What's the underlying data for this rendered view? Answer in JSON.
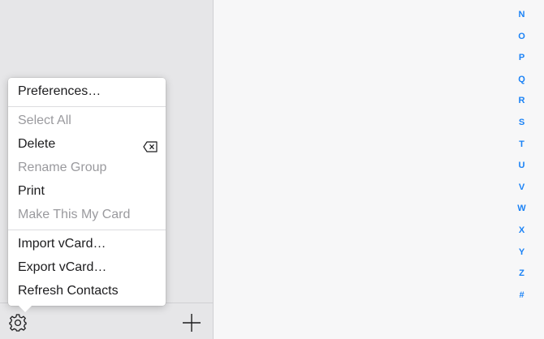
{
  "sidebar": {
    "footer": {
      "settings_icon": "gear-icon",
      "add_icon": "plus-icon"
    }
  },
  "menu": {
    "items": [
      {
        "label": "Preferences…",
        "enabled": true
      },
      {
        "label": "Select All",
        "enabled": false
      },
      {
        "label": "Delete",
        "enabled": true,
        "shortcut_icon": "delete-key-icon"
      },
      {
        "label": "Rename Group",
        "enabled": false
      },
      {
        "label": "Print",
        "enabled": true
      },
      {
        "label": "Make This My Card",
        "enabled": false
      },
      {
        "label": "Import vCard…",
        "enabled": true
      },
      {
        "label": "Export vCard…",
        "enabled": true
      },
      {
        "label": "Refresh Contacts",
        "enabled": true
      }
    ]
  },
  "index": {
    "letters": [
      "N",
      "O",
      "P",
      "Q",
      "R",
      "S",
      "T",
      "U",
      "V",
      "W",
      "X",
      "Y",
      "Z",
      "#"
    ],
    "color": "#1a82f6"
  }
}
